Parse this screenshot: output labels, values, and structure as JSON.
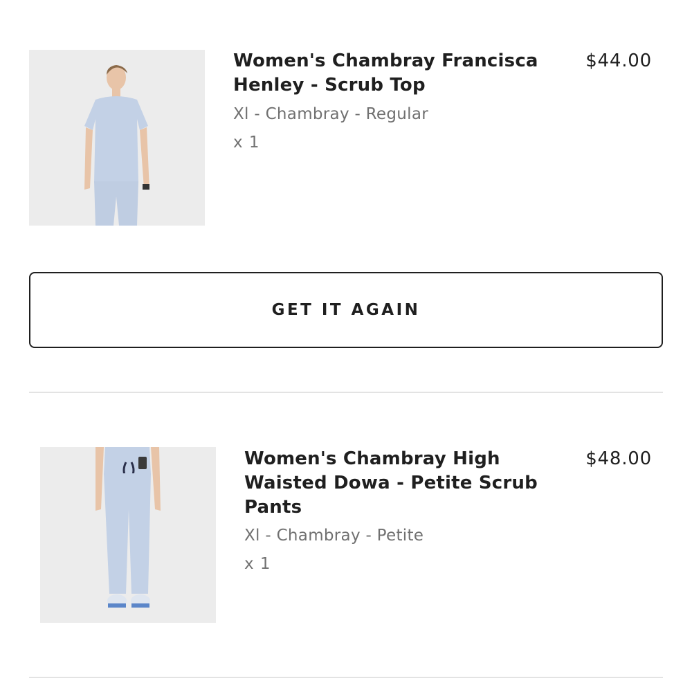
{
  "items": [
    {
      "title_line1": "Women's Chambray Francisca",
      "title_line2": "Henley - Scrub Top",
      "price": "$44.00",
      "variant": "Xl - Chambray - Regular",
      "quantity": "x 1",
      "image_icon": "product-photo-scrub-top"
    },
    {
      "title_line1": "Women's Chambray High",
      "title_line2": "Waisted Dowa - Petite Scrub",
      "title_line3": "Pants",
      "price": "$48.00",
      "variant": "Xl - Chambray - Petite",
      "quantity": "x 1",
      "image_icon": "product-photo-scrub-pants"
    }
  ],
  "buttons": {
    "get_it_again": "GET IT AGAIN"
  },
  "colors": {
    "text": "#1f1f1f",
    "muted": "#707070",
    "divider": "#e3e3e3",
    "chambray": "#c3d1e6"
  }
}
